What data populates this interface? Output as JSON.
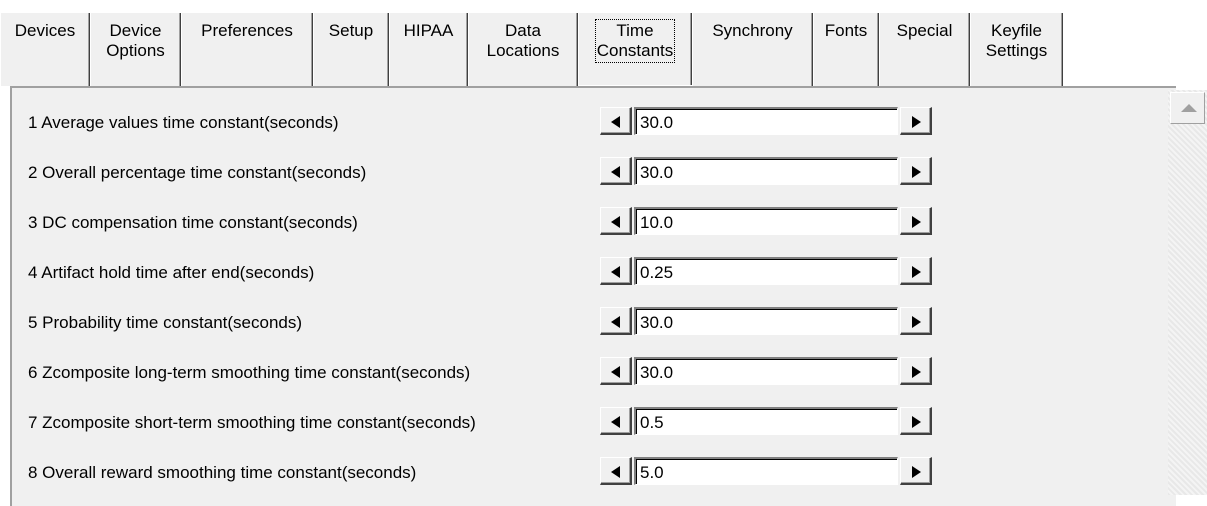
{
  "tabs": [
    {
      "label": "Devices"
    },
    {
      "label": "Device\nOptions"
    },
    {
      "label": "Preferences"
    },
    {
      "label": "Setup"
    },
    {
      "label": "HIPAA"
    },
    {
      "label": "Data\nLocations"
    },
    {
      "label": "Time\nConstants",
      "active": true
    },
    {
      "label": "Synchrony"
    },
    {
      "label": "Fonts"
    },
    {
      "label": "Special"
    },
    {
      "label": "Keyfile\nSettings"
    }
  ],
  "settings": [
    {
      "label": "1 Average values time constant(seconds)",
      "value": "30.0"
    },
    {
      "label": "2 Overall percentage time constant(seconds)",
      "value": "30.0"
    },
    {
      "label": "3 DC compensation time constant(seconds)",
      "value": "10.0"
    },
    {
      "label": "4 Artifact hold time after end(seconds)",
      "value": "0.25"
    },
    {
      "label": "5 Probability time constant(seconds)",
      "value": "30.0"
    },
    {
      "label": "6 Zcomposite long-term smoothing time constant(seconds)",
      "value": "30.0"
    },
    {
      "label": "7 Zcomposite short-term smoothing time constant(seconds)",
      "value": "0.5"
    },
    {
      "label": "8 Overall reward smoothing time constant(seconds)",
      "value": "5.0"
    }
  ]
}
